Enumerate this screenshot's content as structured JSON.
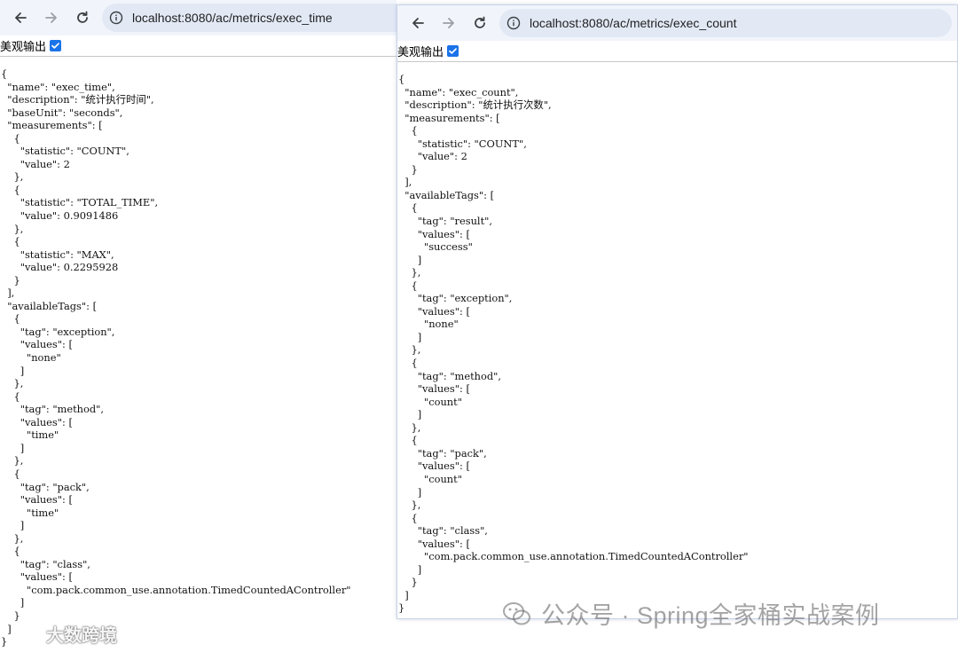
{
  "left_window": {
    "url": "localhost:8080/ac/metrics/exec_time",
    "pretty_label": "美观输出",
    "json_text": "{\n  \"name\": \"exec_time\",\n  \"description\": \"统计执行时间\",\n  \"baseUnit\": \"seconds\",\n  \"measurements\": [\n    {\n      \"statistic\": \"COUNT\",\n      \"value\": 2\n    },\n    {\n      \"statistic\": \"TOTAL_TIME\",\n      \"value\": 0.9091486\n    },\n    {\n      \"statistic\": \"MAX\",\n      \"value\": 0.2295928\n    }\n  ],\n  \"availableTags\": [\n    {\n      \"tag\": \"exception\",\n      \"values\": [\n        \"none\"\n      ]\n    },\n    {\n      \"tag\": \"method\",\n      \"values\": [\n        \"time\"\n      ]\n    },\n    {\n      \"tag\": \"pack\",\n      \"values\": [\n        \"time\"\n      ]\n    },\n    {\n      \"tag\": \"class\",\n      \"values\": [\n        \"com.pack.common_use.annotation.TimedCountedAController\"\n      ]\n    }\n  ]\n}"
  },
  "right_window": {
    "url": "localhost:8080/ac/metrics/exec_count",
    "pretty_label": "美观输出",
    "json_text": "{\n  \"name\": \"exec_count\",\n  \"description\": \"统计执行次数\",\n  \"measurements\": [\n    {\n      \"statistic\": \"COUNT\",\n      \"value\": 2\n    }\n  ],\n  \"availableTags\": [\n    {\n      \"tag\": \"result\",\n      \"values\": [\n        \"success\"\n      ]\n    },\n    {\n      \"tag\": \"exception\",\n      \"values\": [\n        \"none\"\n      ]\n    },\n    {\n      \"tag\": \"method\",\n      \"values\": [\n        \"count\"\n      ]\n    },\n    {\n      \"tag\": \"pack\",\n      \"values\": [\n        \"count\"\n      ]\n    },\n    {\n      \"tag\": \"class\",\n      \"values\": [\n        \"com.pack.common_use.annotation.TimedCountedAController\"\n      ]\n    }\n  ]\n}"
  },
  "watermarks": {
    "wechat": "公众号 · Spring全家桶实战案例",
    "weibo": "大数跨境"
  },
  "icons": [
    "back-arrow-icon",
    "forward-arrow-icon",
    "reload-icon",
    "info-icon",
    "checkbox-checked-icon",
    "wechat-icon",
    "weibo-icon"
  ],
  "colors": {
    "toolbar": "#f1f5fb",
    "omnibox": "#e2e9f5",
    "checkbox": "#1a73e8"
  }
}
